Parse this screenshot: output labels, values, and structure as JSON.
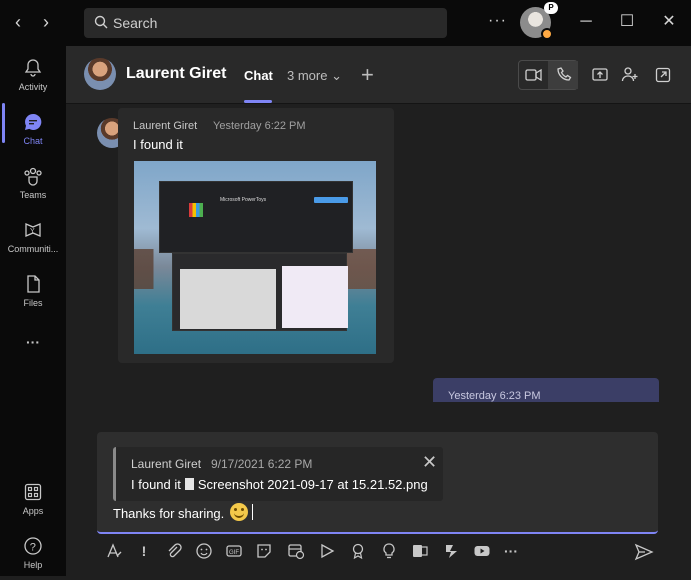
{
  "titlebar": {
    "search_placeholder": "Search",
    "more_label": "···",
    "profile_badge": "P"
  },
  "rail": {
    "items": [
      {
        "label": "Activity"
      },
      {
        "label": "Chat"
      },
      {
        "label": "Teams"
      },
      {
        "label": "Communiti..."
      },
      {
        "label": "Files"
      },
      {
        "label": "···"
      },
      {
        "label": "Apps"
      },
      {
        "label": "Help"
      }
    ],
    "active": "Chat"
  },
  "header": {
    "contact_name": "Laurent Giret",
    "tab_chat": "Chat",
    "more_tabs": "3 more",
    "add_tab": "+"
  },
  "messages": {
    "incoming": {
      "sender": "Laurent Giret",
      "time": "Yesterday 6:22 PM",
      "text": "I found it",
      "image_title": "Microsoft PowerToys"
    },
    "outgoing": {
      "time": "Yesterday 6:23 PM"
    }
  },
  "composer": {
    "quote": {
      "sender": "Laurent Giret",
      "time": "9/17/2021 6:22 PM",
      "text": "I found it",
      "attachment": "Screenshot 2021-09-17 at 15.21.52.png"
    },
    "draft": "Thanks for sharing."
  },
  "colors": {
    "accent": "#7f85f5",
    "available": "#92c353",
    "away": "#ffaa44"
  }
}
